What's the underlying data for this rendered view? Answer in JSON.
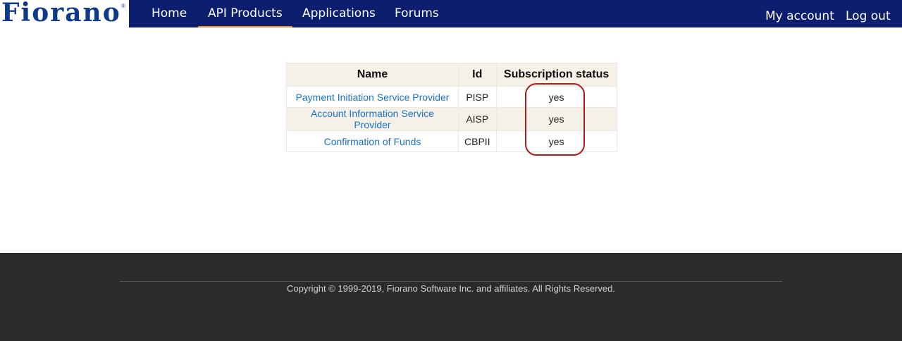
{
  "brand": {
    "logo_text": "Fiorano",
    "registered_mark": "®",
    "logo_color": "#0d3a8c"
  },
  "nav": {
    "items": [
      {
        "label": "Home"
      },
      {
        "label": "API Products",
        "active": true
      },
      {
        "label": "Applications"
      },
      {
        "label": "Forums"
      }
    ],
    "right": [
      {
        "label": "My account"
      },
      {
        "label": "Log out"
      }
    ],
    "bar_color": "#0b1f6e",
    "active_underline_color": "#e8912b"
  },
  "products_table": {
    "headers": [
      "Name",
      "Id",
      "Subscription status"
    ],
    "rows": [
      {
        "name": "Payment Initiation Service Provider",
        "id": "PISP",
        "status": "yes"
      },
      {
        "name": "Account Information Service Provider",
        "id": "AISP",
        "status": "yes"
      },
      {
        "name": "Confirmation of Funds",
        "id": "CBPII",
        "status": "yes"
      }
    ],
    "link_color": "#1a73c6",
    "highlight_color": "#b01c1c"
  },
  "footer": {
    "copyright": "Copyright © 1999-2019, Fiorano Software Inc. and affiliates. All Rights Reserved.",
    "background": "#2b2b2b"
  }
}
